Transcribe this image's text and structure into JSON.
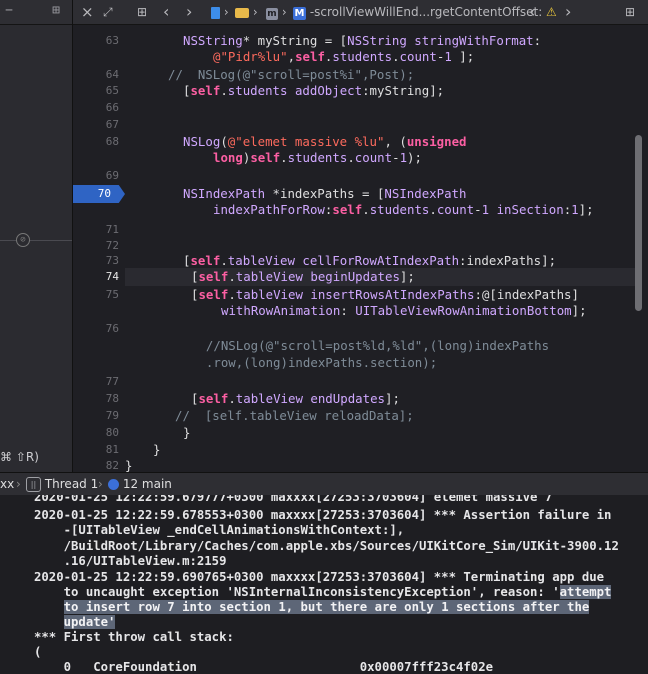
{
  "left_pane": {
    "tab_right_icon": "split-editor-icon",
    "shortcut_text": "⌘ ⇧R)"
  },
  "toolbar": {
    "close_icon": "×",
    "related_items_icon": "related-items-icon",
    "grid_icon": "grid-icon",
    "back_icon": "‹",
    "forward_icon": "›",
    "breadcrumb_method": "-scrollViewWillEnd...rgetContentOffset:",
    "prev_issue_icon": "‹",
    "warning_icon": "⚠",
    "next_issue_icon": "›",
    "add_editor_icon": "split-editor-icon"
  },
  "editor": {
    "current_line": "70",
    "line_numbers": [
      "63",
      "64",
      "65",
      "66",
      "67",
      "68",
      "69",
      "70",
      "71",
      "72",
      "73",
      "74",
      "75",
      "76",
      "77",
      "78",
      "79",
      "80",
      "81",
      "82"
    ]
  },
  "console_bar": {
    "process": "xx",
    "thread": "Thread 1",
    "frame": "12 main"
  },
  "console": {
    "lines": [
      "2020-01-25 12:22:59.679777+0300 maxxxx[27253:3703604] elemet massive 7",
      "2020-01-25 12:22:59.678553+0300 maxxxx[27253:3703604] *** Assertion failure in",
      "    -[UITableView _endCellAnimationsWithContext:],",
      "    /BuildRoot/Library/Caches/com.apple.xbs/Sources/UIKitCore_Sim/UIKit-3900.12",
      "    .16/UITableView.m:2159",
      "2020-01-25 12:22:59.690765+0300 maxxxx[27253:3703604] *** Terminating app due",
      "    to uncaught exception 'NSInternalInconsistencyException', reason: '",
      "    to insert row 7 into section 1, but there are only 1 sections after the",
      "    update'",
      "*** First throw call stack:",
      "(",
      "    0   CoreFoundation                      0x00007fff23c4f02e"
    ],
    "highlight_tail": "attempt",
    "highlight_line8": "to insert row 7 into section 1, but there are only 1 sections after the",
    "highlight_line9": "update'"
  }
}
